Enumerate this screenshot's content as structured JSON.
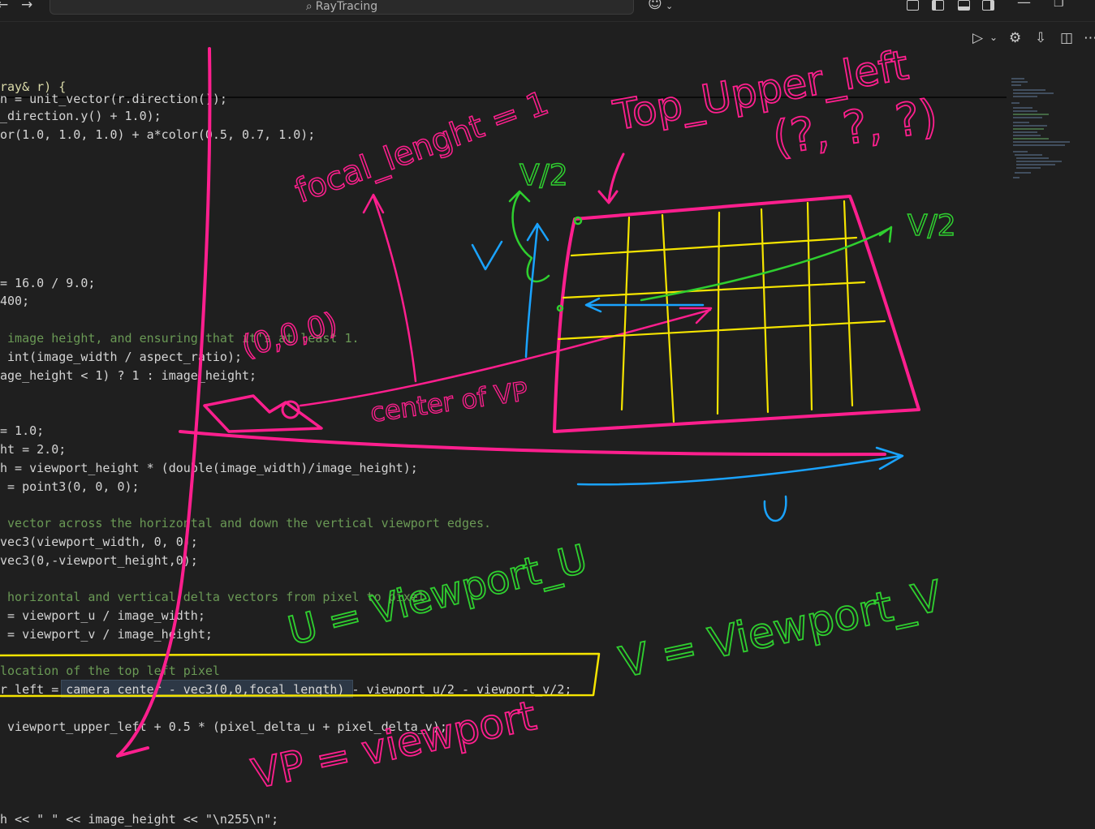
{
  "titlebar": {
    "search_text": "RayTracing",
    "icons": [
      "back-arrow-icon",
      "forward-arrow-icon",
      "search-icon",
      "copilot-icon",
      "layout-icons",
      "minimize-icon",
      "restore-icon"
    ]
  },
  "toolbar": {
    "icons": [
      "run-icon",
      "run-dropdown-icon",
      "settings-gear-icon",
      "download-icon",
      "split-editor-icon",
      "more-icon"
    ]
  },
  "code_lines": [
    {
      "text": "ray& r) {",
      "color": "#dcdcaa"
    },
    {
      "text": "n = unit_vector(r.direction());",
      "color": "#d4d4d4"
    },
    {
      "text": "_direction.y() + 1.0);",
      "color": "#d4d4d4"
    },
    {
      "text": "or(1.0, 1.0, 1.0) + a*color(0.5, 0.7, 1.0);",
      "color": "#d4d4d4"
    },
    {
      "text": "= 16.0 / 9.0;",
      "color": "#d4d4d4"
    },
    {
      "text": "400;",
      "color": "#d4d4d4"
    },
    {
      "text": " image height, and ensuring that it's at least 1.",
      "color": "#6a9955"
    },
    {
      "text": " int(image_width / aspect_ratio);",
      "color": "#d4d4d4"
    },
    {
      "text": "age_height < 1) ? 1 : image_height;",
      "color": "#d4d4d4"
    },
    {
      "text": "= 1.0;",
      "color": "#d4d4d4"
    },
    {
      "text": "ht = 2.0;",
      "color": "#d4d4d4"
    },
    {
      "text": "h = viewport_height * (double(image_width)/image_height);",
      "color": "#d4d4d4"
    },
    {
      "text": " = point3(0, 0, 0);",
      "color": "#d4d4d4"
    },
    {
      "text": " vector across the horizontal and down the vertical viewport edges.",
      "color": "#6a9955"
    },
    {
      "text": "vec3(viewport_width, 0, 0);",
      "color": "#d4d4d4"
    },
    {
      "text": "vec3(0,-viewport_height,0);",
      "color": "#d4d4d4"
    },
    {
      "text": " horizontal and vertical delta vectors from pixel to pixel.",
      "color": "#6a9955"
    },
    {
      "text": " = viewport_u / image_width;",
      "color": "#d4d4d4"
    },
    {
      "text": " = viewport_v / image_height;",
      "color": "#d4d4d4"
    },
    {
      "text": "location of the top left pixel",
      "color": "#6a9955"
    },
    {
      "text": "r_left = camera_center - vec3(0,0,focal_length) - viewport_u/2 - viewport_v/2;",
      "color": "#d4d4d4"
    },
    {
      "text": " viewport_upper_left + 0.5 * (pixel_delta_u + pixel_delta_v);",
      "color": "#d4d4d4"
    },
    {
      "text": "h << \" \" << image_height << \"\\n255\\n\";",
      "color": "#d4d4d4"
    }
  ],
  "annotations": {
    "focal_length": "focal_lenght = 1",
    "top_upper_left": "Top_Upper_left",
    "unknowns": "(?, ?, ?)",
    "origin": "(0,0,0)",
    "center_of_vp": "center of VP",
    "v_half_left": "V/2",
    "v_half_right": "V/2",
    "v_label": "V",
    "u_label": "U",
    "u_def": "U = Viewport_U",
    "v_def": "V = Viewport_V",
    "vp_def": "VP = viewport"
  },
  "colors": {
    "pink": "#ff1f8e",
    "yellow": "#f5e400",
    "green": "#2fcf2f",
    "blue": "#1aa3ff",
    "highlight_box": "#f5e400"
  }
}
